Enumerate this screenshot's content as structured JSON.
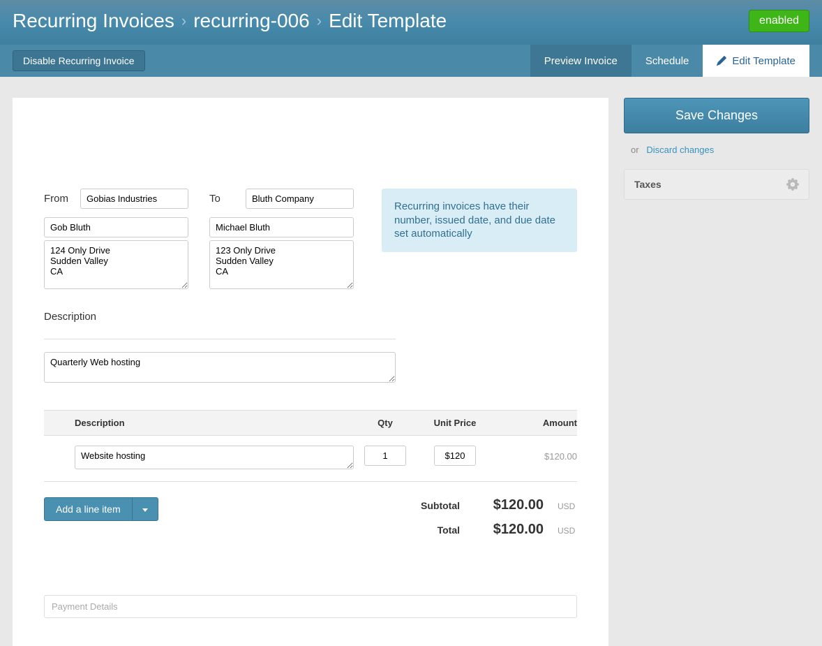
{
  "header": {
    "breadcrumb": [
      "Recurring Invoices",
      "recurring-006",
      "Edit Template"
    ],
    "status_badge": "enabled"
  },
  "toolbar": {
    "disable_label": "Disable Recurring Invoice",
    "tabs": {
      "preview": "Preview Invoice",
      "schedule": "Schedule",
      "edit": "Edit Template"
    }
  },
  "side": {
    "save_label": "Save Changes",
    "or_text": "or",
    "discard_label": "Discard changes",
    "taxes_label": "Taxes"
  },
  "form": {
    "from_label": "From",
    "to_label": "To",
    "from": {
      "company": "Gobias Industries",
      "name": "Gob Bluth",
      "address": "124 Only Drive\nSudden Valley\nCA"
    },
    "to": {
      "company": "Bluth Company",
      "name": "Michael Bluth",
      "address": "123 Only Drive\nSudden Valley\nCA"
    },
    "info_box": "Recurring invoices have their number, issued date, and due date set automatically",
    "description_label": "Description",
    "description_value": "Quarterly Web hosting",
    "table": {
      "headers": {
        "description": "Description",
        "qty": "Qty",
        "price": "Unit Price",
        "amount": "Amount"
      },
      "rows": [
        {
          "description": "Website hosting",
          "qty": "1",
          "price": "$120",
          "amount": "$120.00"
        }
      ]
    },
    "add_line_label": "Add a line item",
    "totals": {
      "subtotal_label": "Subtotal",
      "subtotal_value": "$120.00",
      "total_label": "Total",
      "total_value": "$120.00",
      "currency": "USD"
    },
    "payment_details_placeholder": "Payment Details"
  }
}
